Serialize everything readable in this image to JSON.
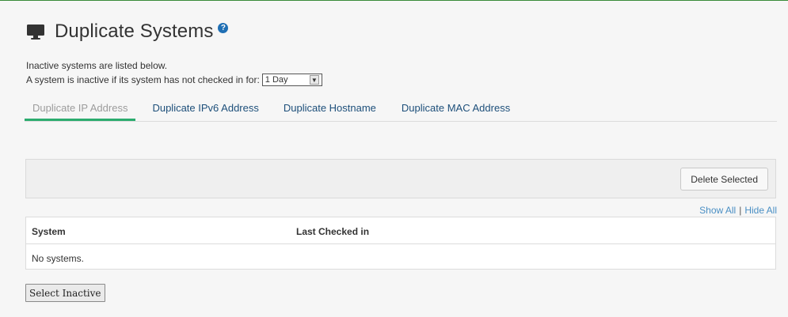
{
  "header": {
    "title": "Duplicate Systems",
    "help_glyph": "?",
    "icon": "monitor-icon"
  },
  "info": {
    "line1": "Inactive systems are listed below.",
    "line2": "A system is inactive if its system has not checked in for:",
    "inactive_period": "1 Day"
  },
  "tabs": [
    {
      "label": "Duplicate IP Address",
      "active": true
    },
    {
      "label": "Duplicate IPv6 Address",
      "active": false
    },
    {
      "label": "Duplicate Hostname",
      "active": false
    },
    {
      "label": "Duplicate MAC Address",
      "active": false
    }
  ],
  "toolbar": {
    "delete_label": "Delete Selected"
  },
  "list_controls": {
    "show_all": "Show All",
    "separator": "|",
    "hide_all": "Hide All"
  },
  "table": {
    "columns": [
      "System",
      "Last Checked in"
    ],
    "empty_message": "No systems."
  },
  "footer": {
    "select_inactive_label": "Select Inactive"
  },
  "colors": {
    "accent_green": "#2bac6e",
    "link_blue": "#4a8fc4",
    "tab_blue": "#1d4f7a",
    "help_blue": "#1f6fb4"
  }
}
